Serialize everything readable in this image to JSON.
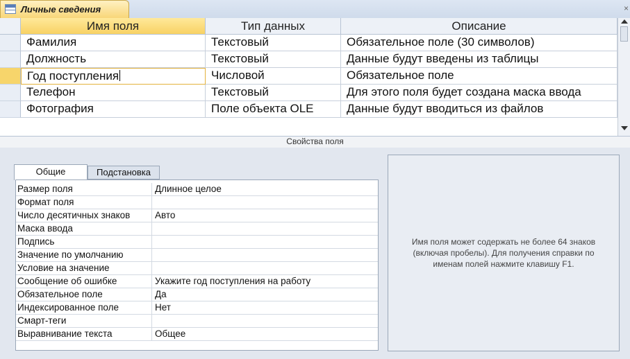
{
  "window": {
    "tab_title": "Личные сведения",
    "close_glyph": "×"
  },
  "grid": {
    "columns": [
      "Имя поля",
      "Тип данных",
      "Описание"
    ],
    "rows": [
      {
        "name": "Фамилия",
        "type": "Текстовый",
        "description": "Обязательное поле (30 символов)"
      },
      {
        "name": "Должность",
        "type": "Текстовый",
        "description": "Данные будут введены из таблицы"
      },
      {
        "name": "Год поступления",
        "type": "Числовой",
        "description": "Обязательное поле"
      },
      {
        "name": "Телефон",
        "type": "Текстовый",
        "description": "Для этого поля будет создана маска ввода"
      },
      {
        "name": "Фотография",
        "type": "Поле объекта OLE",
        "description": "Данные будут вводиться из файлов"
      }
    ]
  },
  "properties_label": "Свойства поля",
  "property_tabs": [
    "Общие",
    "Подстановка"
  ],
  "properties": [
    {
      "name": "Размер поля",
      "value": "Длинное целое"
    },
    {
      "name": "Формат поля",
      "value": ""
    },
    {
      "name": "Число десятичных знаков",
      "value": "Авто"
    },
    {
      "name": "Маска ввода",
      "value": ""
    },
    {
      "name": "Подпись",
      "value": ""
    },
    {
      "name": "Значение по умолчанию",
      "value": ""
    },
    {
      "name": "Условие на значение",
      "value": ""
    },
    {
      "name": "Сообщение об ошибке",
      "value": "Укажите год поступления на работу"
    },
    {
      "name": "Обязательное поле",
      "value": "Да"
    },
    {
      "name": "Индексированное поле",
      "value": "Нет"
    },
    {
      "name": "Смарт-теги",
      "value": ""
    },
    {
      "name": "Выравнивание текста",
      "value": "Общее"
    }
  ],
  "help_text": "Имя поля может содержать не более 64 знаков (включая пробелы). Для получения справки по именам полей нажмите клавишу F1."
}
